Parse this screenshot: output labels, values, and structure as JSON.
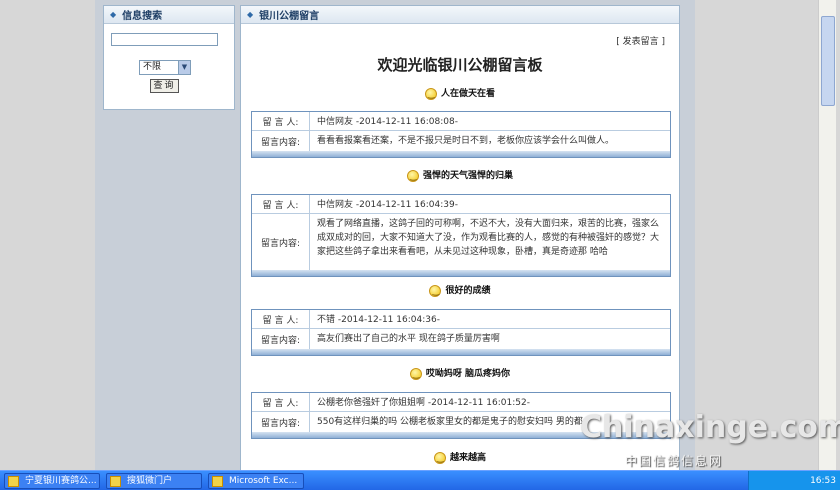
{
  "search": {
    "title": "信息搜索",
    "select_value": "不限",
    "query_button": "查询"
  },
  "board": {
    "panel_title": "银川公棚留言",
    "post_link": "[ 发表留言 ]",
    "title": "欢迎光临银川公棚留言板"
  },
  "labels": {
    "author": "留 言 人:",
    "content": "留言内容:"
  },
  "messages": [
    {
      "title": "人在做天在看",
      "author": "中信网友 -2014-12-11 16:08:08-",
      "content": "看看看报案看还案，不是不报只是时日不到，老板你应该学会什么叫做人。"
    },
    {
      "title": "强悍的天气强悍的归巢",
      "author": "中信网友 -2014-12-11 16:04:39-",
      "content": "观看了网络直播，这鸽子回的可称啊，不迟不大，没有大面归来，艰苦的比赛，强家么成双成对的回，大家不知道大了没，作为观看比赛的人，感觉的有种被强奸的感觉？大家把这些鸽子拿出来看看吧，从未见过这种现象，卧槽，真是奇迹那 哈哈"
    },
    {
      "title": "很好的成绩",
      "author": "不错 -2014-12-11 16:04:36-",
      "content": "高友们赛出了自己的水平 现在鸽子质量厉害啊"
    },
    {
      "title": "哎呦妈呀 脑瓜疼妈你",
      "author": "公棚老你爸强奸了你姐姐啊 -2014-12-11 16:01:52-",
      "content": "550有这样归巢的吗 公棚老板家里女的都是鬼子的慰安妇吗 男的都"
    },
    {
      "title": "越来越高"
    }
  ],
  "watermark": {
    "main": "Chinaxinge.com",
    "sub": "中国信鸽信息网"
  },
  "taskbar": {
    "items": [
      "宁夏银川赛鸽公...",
      "搜狐微门户",
      "Microsoft Exc..."
    ],
    "clock": "16:53"
  }
}
